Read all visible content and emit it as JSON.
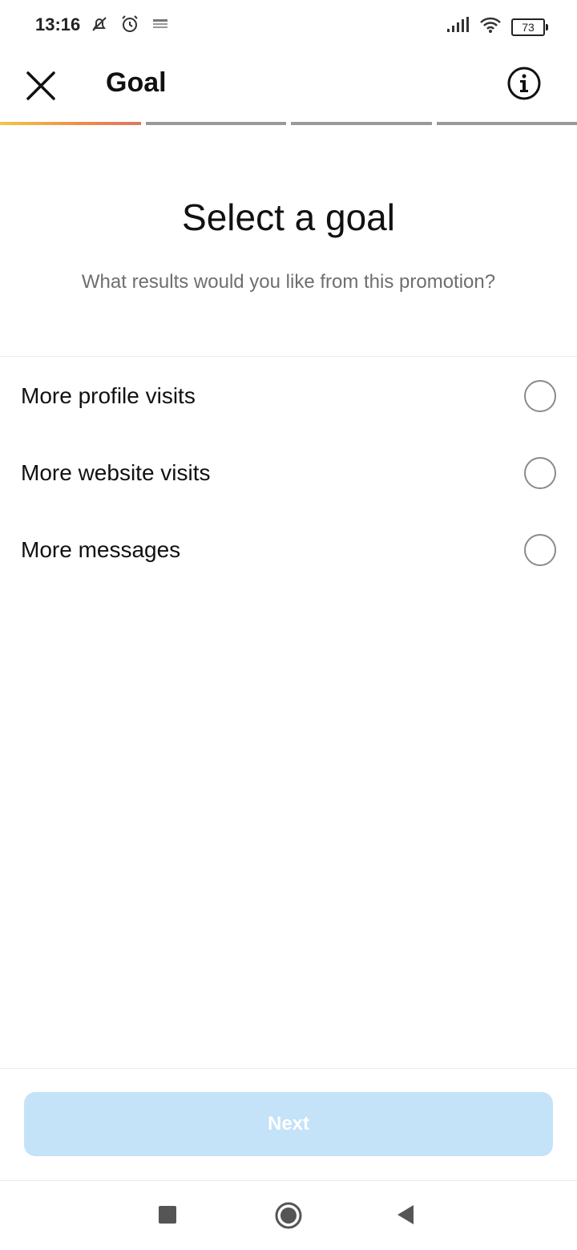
{
  "status_bar": {
    "time": "13:16",
    "battery": "73",
    "left_icons": [
      "alarm-off-icon",
      "alarm-clock-icon",
      "notification-icon"
    ],
    "right_icons": [
      "signal-icon",
      "wifi-icon",
      "battery-icon"
    ]
  },
  "header": {
    "title": "Goal",
    "close_icon": "close-icon",
    "info_icon": "info-icon"
  },
  "progress": {
    "total_steps": 4,
    "current_step": 1
  },
  "intro": {
    "title": "Select a goal",
    "subtitle": "What results would you like from this promotion?"
  },
  "options": [
    {
      "label": "More profile visits",
      "selected": false
    },
    {
      "label": "More website visits",
      "selected": false
    },
    {
      "label": "More messages",
      "selected": false
    }
  ],
  "footer": {
    "next_label": "Next",
    "next_enabled": false
  },
  "nav_bar": {
    "icons": [
      "recents-icon",
      "home-icon",
      "back-icon"
    ]
  },
  "colors": {
    "next_button_disabled": "#c4e2f8",
    "progress_active_start": "#f5c542",
    "progress_active_end": "#e07562",
    "progress_inactive": "#999999"
  }
}
